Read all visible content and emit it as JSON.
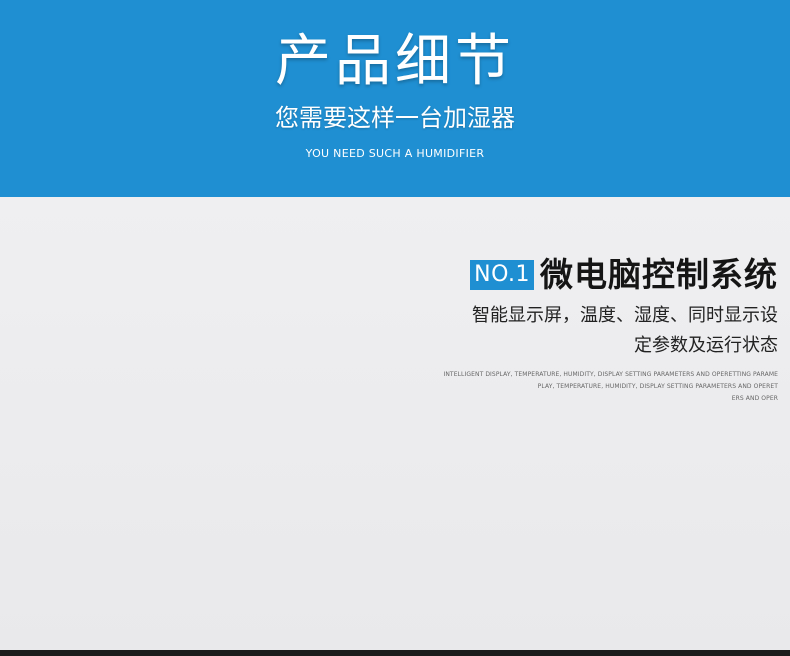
{
  "banner": {
    "title": "产品细节",
    "subtitle": "您需要这样一台加湿器",
    "english": "YOU NEED SUCH A HUMIDIFIER"
  },
  "feature": {
    "badge": "NO.1",
    "title": "微电脑控制系统",
    "desc_line1": "智能显示屏，温度、湿度、同时显示设",
    "desc_line2": "定参数及运行状态",
    "english_line1": "INTELLIGENT DISPLAY, TEMPERATURE, HUMIDITY, DISPLAY SETTING PARAMETERS AND OPERETTING PARAME",
    "english_line2": "PLAY, TEMPERATURE, HUMIDITY, DISPLAY SETTING PARAMETERS AND OPERET",
    "english_line3": "ERS AND OPER"
  },
  "colors": {
    "accent_blue": "#1f8fd2",
    "background": "#ececee",
    "title_text": "#151515"
  }
}
